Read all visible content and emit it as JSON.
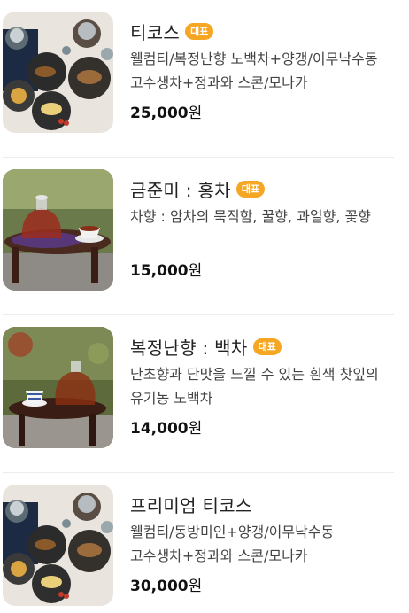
{
  "products": [
    {
      "name": "티코스",
      "badge": "대표",
      "description": "웰컴티/복정난향 노백차+양갱/이무낙수동 고수생차+정과와 스콘/모나카",
      "price": "25,000",
      "currency": "원",
      "image": "tea-course-table-photo"
    },
    {
      "name": "금준미 : 홍차",
      "badge": "대표",
      "description": "차향 : 암차의 묵직함, 꿀향, 과일향, 꽃향",
      "price": "15,000",
      "currency": "원",
      "image": "black-tea-glass-teapot-photo"
    },
    {
      "name": "복정난향 : 백차",
      "badge": "대표",
      "description": "난초향과 단맛을 느낄 수 있는 흰색 찻잎의 유기농 노백차",
      "price": "14,000",
      "currency": "원",
      "image": "white-tea-glass-teapot-photo"
    },
    {
      "name": "프리미엄 티코스",
      "badge": "",
      "description": "웰컴티/동방미인+양갱/이무낙수동 고수생차+정과와 스콘/모나카",
      "price": "30,000",
      "currency": "원",
      "image": "premium-tea-course-table-photo"
    }
  ]
}
